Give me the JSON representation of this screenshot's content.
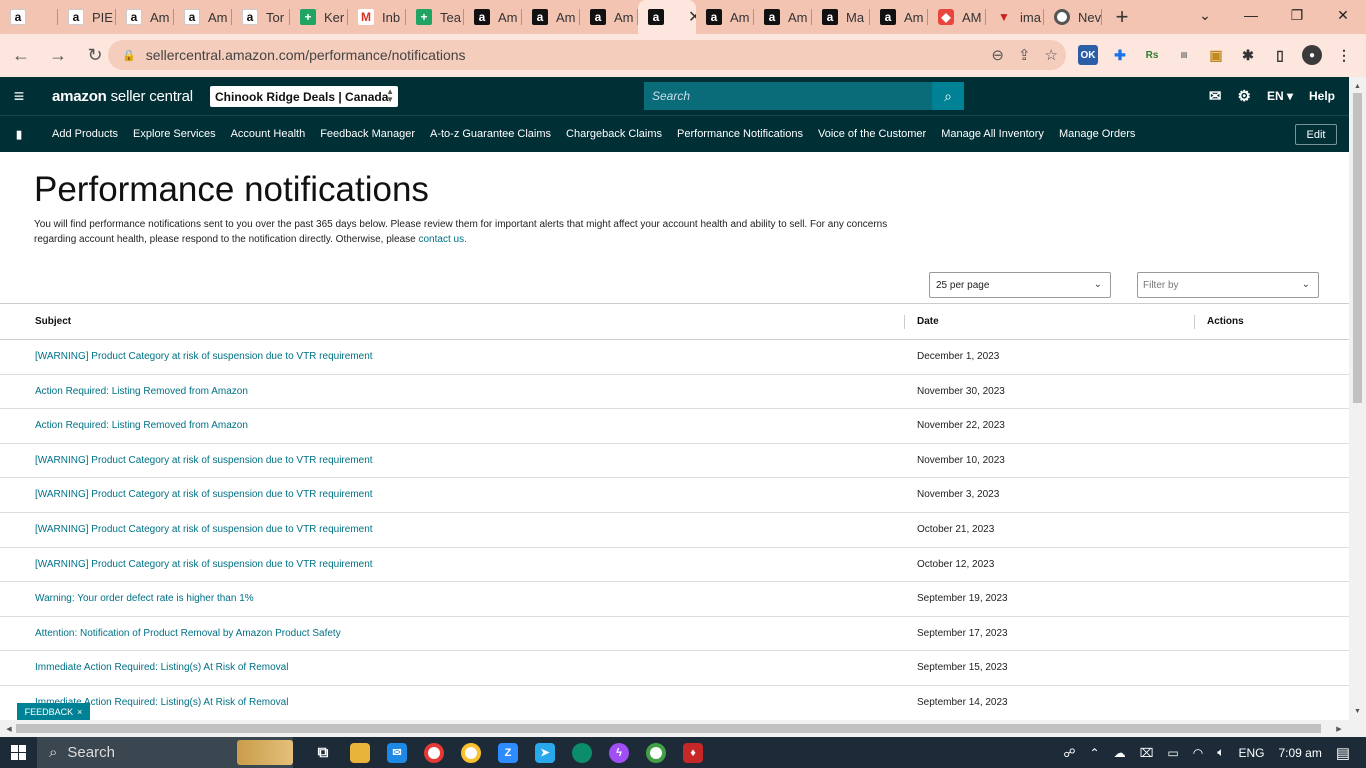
{
  "browser": {
    "tabs": [
      {
        "title": "",
        "icon": "amazon"
      },
      {
        "title": "PIE",
        "icon": "amazon"
      },
      {
        "title": "Am",
        "icon": "amazon"
      },
      {
        "title": "Am",
        "icon": "amazon"
      },
      {
        "title": "Tor",
        "icon": "amazon"
      },
      {
        "title": "Ker",
        "icon": "sheets"
      },
      {
        "title": "Inb",
        "icon": "gmail"
      },
      {
        "title": "Tea",
        "icon": "sheets"
      },
      {
        "title": "Am",
        "icon": "amazon-dark"
      },
      {
        "title": "Am",
        "icon": "amazon-dark"
      },
      {
        "title": "Am",
        "icon": "amazon-dark"
      },
      {
        "title": "",
        "icon": "amazon-dark",
        "active": true
      },
      {
        "title": "Am",
        "icon": "amazon-dark"
      },
      {
        "title": "Am",
        "icon": "amazon-dark"
      },
      {
        "title": "Ma",
        "icon": "amazon-dark"
      },
      {
        "title": "Am",
        "icon": "amazon-dark"
      },
      {
        "title": "AM",
        "icon": "pdf"
      },
      {
        "title": "ima",
        "icon": "red"
      },
      {
        "title": "Nev",
        "icon": "chrome"
      }
    ],
    "url": "sellercentral.amazon.com/performance/notifications"
  },
  "header": {
    "logo_bold": "amazon",
    "logo_light": " seller central",
    "store": "Chinook Ridge Deals | Canada",
    "search_placeholder": "Search",
    "language": "EN",
    "help": "Help"
  },
  "nav": {
    "links": [
      "Add Products",
      "Explore Services",
      "Account Health",
      "Feedback Manager",
      "A-to-z Guarantee Claims",
      "Chargeback Claims",
      "Performance Notifications",
      "Voice of the Customer",
      "Manage All Inventory",
      "Manage Orders"
    ],
    "edit": "Edit"
  },
  "page": {
    "title": "Performance notifications",
    "intro": "You will find performance notifications sent to you over the past 365 days below. Please review them for important alerts that might affect your account health and ability to sell. For any concerns regarding account health, please respond to the notification directly. Otherwise, please ",
    "contact_link": "contact us.",
    "per_page": "25 per page",
    "filter_placeholder": "Filter by"
  },
  "table": {
    "headers": {
      "subject": "Subject",
      "date": "Date",
      "actions": "Actions"
    },
    "rows": [
      {
        "subject": "[WARNING] Product Category at risk of suspension due to VTR requirement",
        "date": "December 1, 2023"
      },
      {
        "subject": "Action Required: Listing Removed from Amazon",
        "date": "November 30, 2023"
      },
      {
        "subject": "Action Required: Listing Removed from Amazon",
        "date": "November 22, 2023"
      },
      {
        "subject": "[WARNING] Product Category at risk of suspension due to VTR requirement",
        "date": "November 10, 2023"
      },
      {
        "subject": "[WARNING] Product Category at risk of suspension due to VTR requirement",
        "date": "November 3, 2023"
      },
      {
        "subject": "[WARNING] Product Category at risk of suspension due to VTR requirement",
        "date": "October 21, 2023"
      },
      {
        "subject": "[WARNING] Product Category at risk of suspension due to VTR requirement",
        "date": "October 12, 2023"
      },
      {
        "subject": "Warning: Your order defect rate is higher than 1%",
        "date": "September 19, 2023"
      },
      {
        "subject": "Attention: Notification of Product Removal by Amazon Product Safety",
        "date": "September 17, 2023"
      },
      {
        "subject": "Immediate Action Required: Listing(s) At Risk of Removal",
        "date": "September 15, 2023"
      },
      {
        "subject": "Immediate Action Required: Listing(s) At Risk of Removal",
        "date": "September 14, 2023"
      }
    ]
  },
  "feedback": "FEEDBACK",
  "taskbar": {
    "search": "Search",
    "language": "ENG",
    "time": "7:09 am"
  },
  "colors": {
    "header_bg": "#002f36",
    "link": "#007185",
    "search_btn": "#008296",
    "tabstrip": "#f4c4b2"
  }
}
